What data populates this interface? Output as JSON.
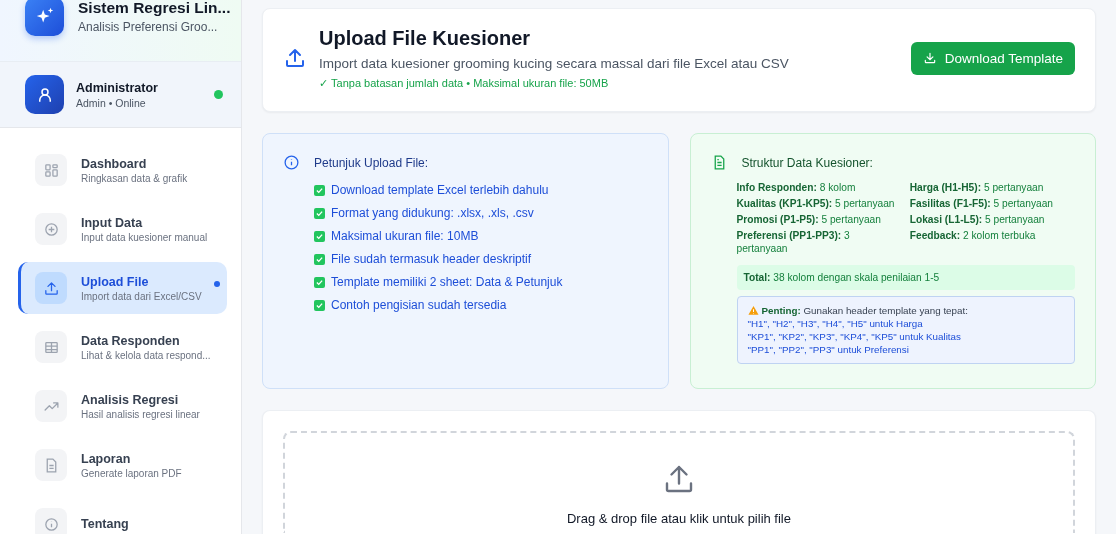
{
  "sidebar": {
    "app": {
      "title": "Sistem Regresi Lin...",
      "subtitle": "Analisis Preferensi Groo..."
    },
    "user": {
      "name": "Administrator",
      "role": "Admin • Online",
      "online": true
    },
    "nav": [
      {
        "title": "Dashboard",
        "subtitle": "Ringkasan data & grafik",
        "selected": false
      },
      {
        "title": "Input Data",
        "subtitle": "Input data kuesioner manual",
        "selected": false
      },
      {
        "title": "Upload File",
        "subtitle": "Import data dari Excel/CSV",
        "selected": true
      },
      {
        "title": "Data Responden",
        "subtitle": "Lihat & kelola data respond...",
        "selected": false
      },
      {
        "title": "Analisis Regresi",
        "subtitle": "Hasil analisis regresi linear",
        "selected": false
      },
      {
        "title": "Laporan",
        "subtitle": "Generate laporan PDF",
        "selected": false
      },
      {
        "title": "Tentang",
        "selected": false
      }
    ]
  },
  "header": {
    "title": "Upload File Kuesioner",
    "subtitle": "Import data kuesioner grooming kucing secara massal dari file Excel atau CSV",
    "note": "✓ Tanpa batasan jumlah data • Maksimal ukuran file: 50MB",
    "button": "Download Template"
  },
  "instructions": {
    "title": "Petunjuk Upload File:",
    "items": [
      {
        "text": "Download template Excel terlebih dahulu",
        "checked": true
      },
      {
        "text": "Format yang didukung: .xlsx, .xls, .csv",
        "checked": true
      },
      {
        "text": "Maksimal ukuran file: 10MB",
        "checked": true
      },
      {
        "text": "File sudah termasuk header deskriptif",
        "checked": true
      },
      {
        "text": "Template memiliki 2 sheet: Data & Petunjuk",
        "checked": true
      },
      {
        "text": "Contoh pengisian sudah tersedia",
        "checked": true
      }
    ]
  },
  "structure": {
    "title": "Struktur Data Kuesioner:",
    "fields": [
      "**Info Responden:** 8 kolom",
      "**Harga (H1-H5):** 5 pertanyaan",
      "**Kualitas (KP1-KP5):** 5 pertanyaan",
      "**Fasilitas (F1-F5):** 5 pertanyaan",
      "**Promosi (P1-P5):** 5 pertanyaan",
      "**Lokasi (L1-L5):** 5 pertanyaan",
      "**Preferensi (PP1-PP3):** 3 pertanyaan",
      "**Feedback:** 2 kolom terbuka"
    ],
    "total": "**Total:** 38 kolom dengan skala penilaian 1-5",
    "warning": {
      "heading": "**Penting:** Gunakan header template yang tepat:",
      "lines": [
        "\"H1\", \"H2\", \"H3\", \"H4\", \"H5\" untuk Harga",
        "\"KP1\", \"KP2\", \"KP3\", \"KP4\", \"KP5\" untuk Kualitas",
        "\"PP1\", \"PP2\", \"PP3\" untuk Preferensi"
      ]
    }
  },
  "dropzone": {
    "text": "Drag & drop file atau klik untuk pilih file"
  }
}
